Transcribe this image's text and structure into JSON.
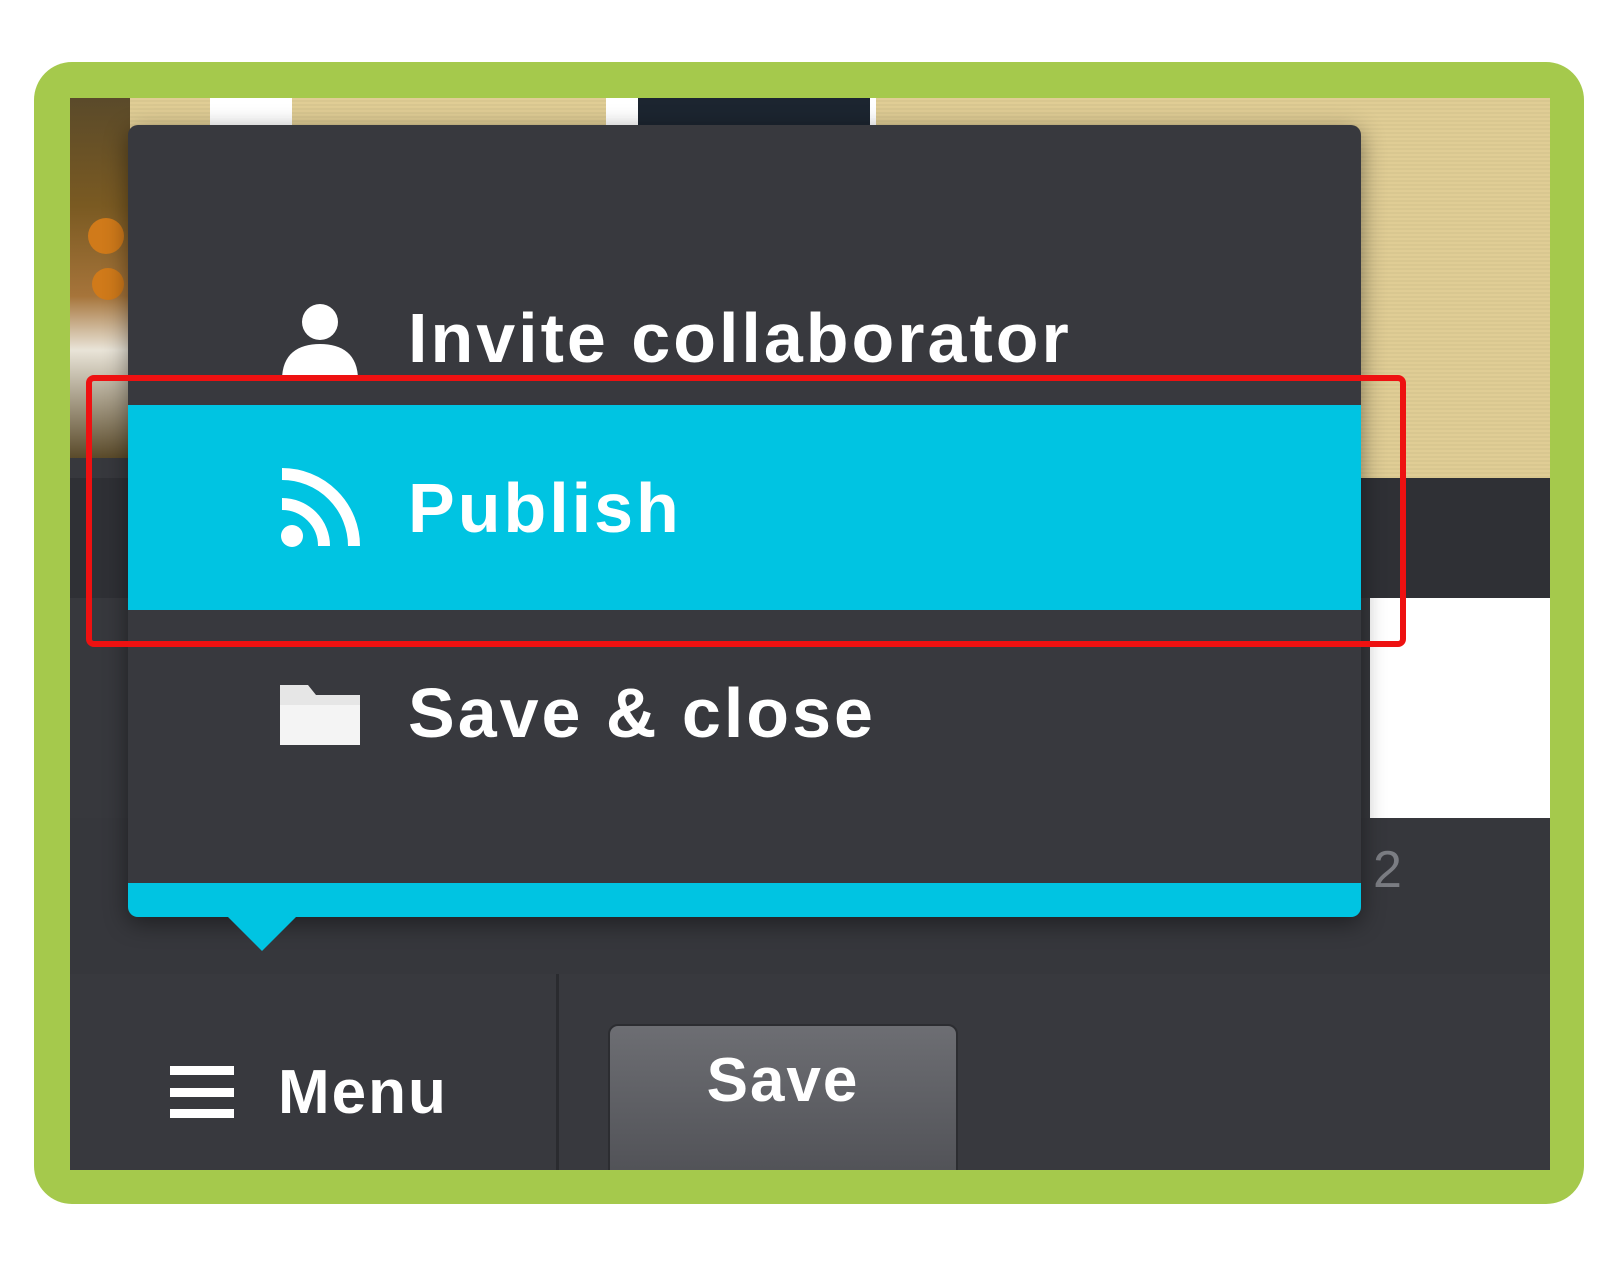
{
  "popup_menu": {
    "items": [
      {
        "label": "Invite collaborator",
        "icon": "user-icon",
        "active": false
      },
      {
        "label": "Publish",
        "icon": "rss-icon",
        "active": true
      },
      {
        "label": "Save & close",
        "icon": "folder-icon",
        "active": false
      }
    ]
  },
  "toolbar": {
    "menu_label": "Menu",
    "save_label": "Save"
  },
  "background": {
    "page_number": "2"
  },
  "colors": {
    "frame_green": "#a5c94c",
    "accent_cyan": "#00c4e2",
    "menu_dark": "#38393e",
    "highlight_red": "#ee1111"
  }
}
